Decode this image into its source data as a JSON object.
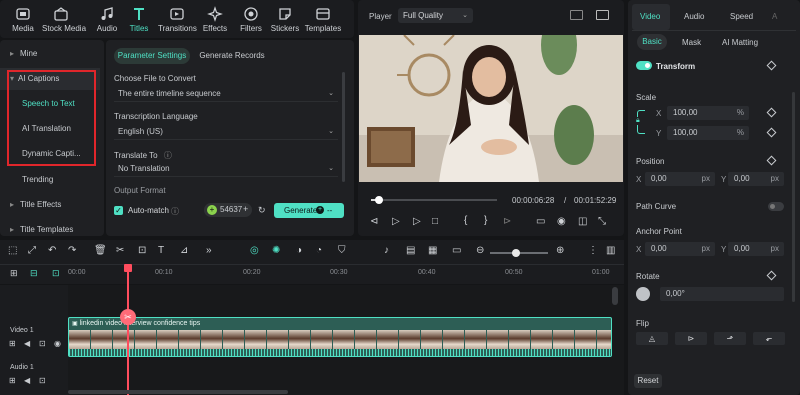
{
  "toolbar": {
    "items": [
      {
        "label": "Media",
        "icon": "media-icon"
      },
      {
        "label": "Stock Media",
        "icon": "stock-media-icon"
      },
      {
        "label": "Audio",
        "icon": "audio-icon"
      },
      {
        "label": "Titles",
        "icon": "titles-icon",
        "active": true
      },
      {
        "label": "Transitions",
        "icon": "transitions-icon"
      },
      {
        "label": "Effects",
        "icon": "effects-icon"
      },
      {
        "label": "Filters",
        "icon": "filters-icon"
      },
      {
        "label": "Stickers",
        "icon": "stickers-icon"
      },
      {
        "label": "Templates",
        "icon": "templates-icon"
      }
    ]
  },
  "sidebar": {
    "items": [
      {
        "label": "Mine"
      },
      {
        "label": "AI Captions"
      },
      {
        "label": "Speech to Text"
      },
      {
        "label": "AI Translation"
      },
      {
        "label": "Dynamic Capti..."
      },
      {
        "label": "Trending"
      },
      {
        "label": "Title Effects"
      },
      {
        "label": "Title Templates"
      }
    ]
  },
  "captions": {
    "tabs": [
      "Parameter Settings",
      "Generate Records"
    ],
    "file_label": "Choose File to Convert",
    "file_value": "The entire timeline sequence",
    "lang_label": "Transcription Language",
    "lang_value": "English (US)",
    "translate_label": "Translate To",
    "translate_value": "No Translation",
    "output_label": "Output Format",
    "automatch_label": "Auto-match",
    "credits": "54637",
    "generate_label": "Generate"
  },
  "player": {
    "label": "Player",
    "quality": "Full Quality",
    "current_time": "00:00:06:28",
    "separator": "/",
    "total_time": "00:01:52:29",
    "progress": 0.06
  },
  "right_panel": {
    "tabs": [
      "Video",
      "Audio",
      "Speed",
      "A"
    ],
    "subtabs": [
      "Basic",
      "Mask",
      "AI Matting"
    ],
    "transform_label": "Transform",
    "scale_label": "Scale",
    "scale_x": "100,00",
    "scale_y": "100,00",
    "scale_unit": "%",
    "position_label": "Position",
    "pos_x": "0,00",
    "pos_y": "0,00",
    "px_unit": "px",
    "path_curve_label": "Path Curve",
    "anchor_label": "Anchor Point",
    "anchor_x": "0,00",
    "anchor_y": "0,00",
    "rotate_label": "Rotate",
    "rotate_value": "0,00°",
    "flip_label": "Flip",
    "reset_label": "Reset",
    "x_label": "X",
    "y_label": "Y"
  },
  "timeline": {
    "ruler": [
      "00:00",
      "00:10",
      "00:20",
      "00:30",
      "00:40",
      "00:50",
      "01:00"
    ],
    "video_track_label": "Video 1",
    "audio_track_label": "Audio 1",
    "clip_title": "linkedin video interview confidence tips"
  },
  "colors": {
    "accent": "#4fe0c4",
    "highlight_box": "#e0262b",
    "playhead": "#ff4d5e"
  }
}
